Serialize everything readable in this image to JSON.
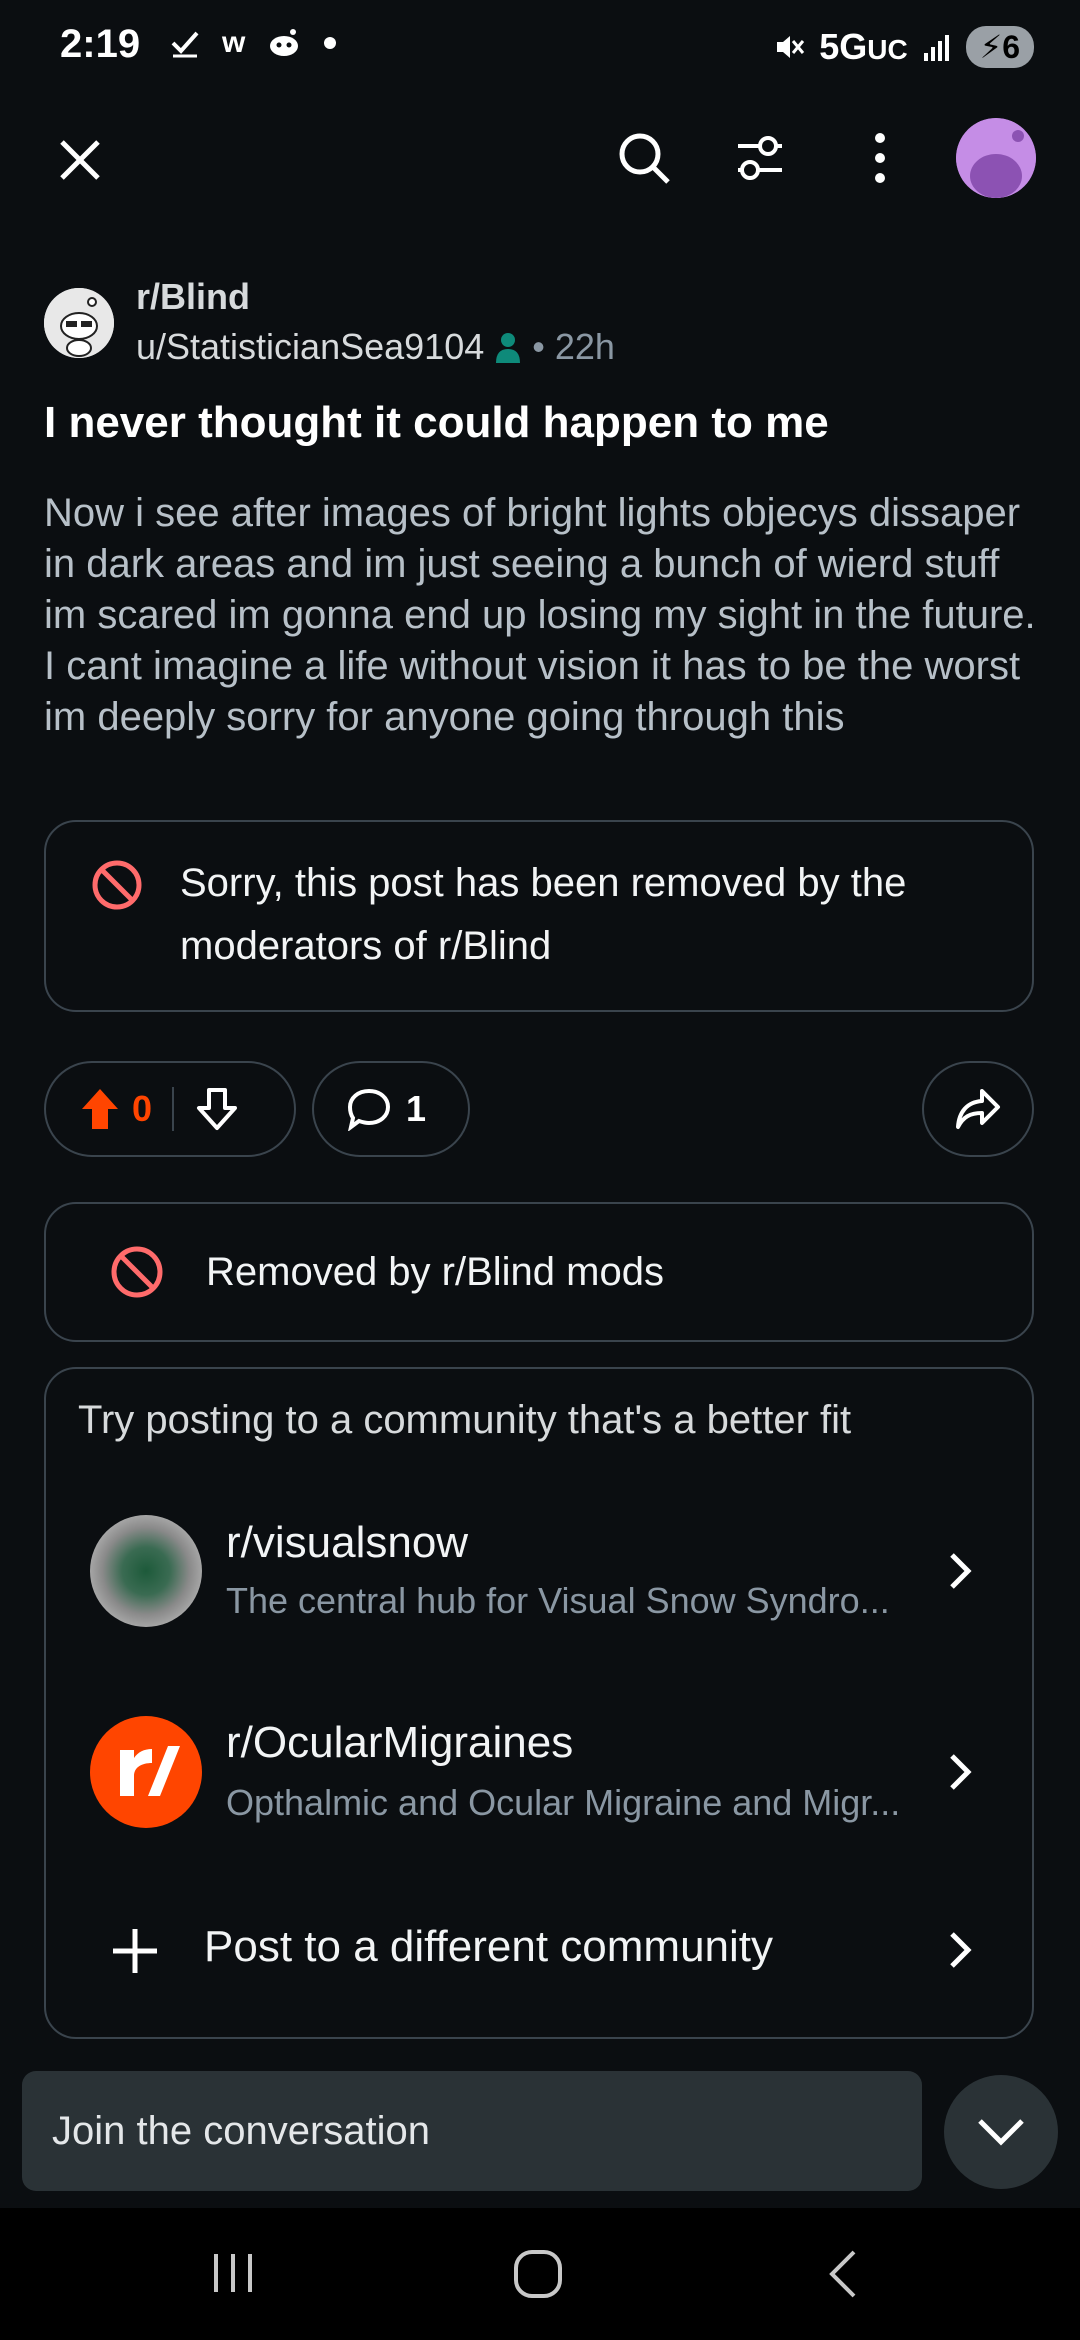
{
  "status_bar": {
    "time": "2:19",
    "network": "5G",
    "network_suffix": "UC",
    "battery": "6",
    "icons": [
      "check-icon",
      "w-icon",
      "reddit-icon",
      "dot-icon",
      "mute-icon",
      "signal-icon",
      "battery-charging-icon"
    ]
  },
  "top_bar": {
    "icons": [
      "close-icon",
      "search-icon",
      "filter-icon",
      "more-icon",
      "avatar"
    ]
  },
  "post": {
    "subreddit": "r/Blind",
    "author": "u/StatisticianSea9104",
    "age": "• 22h",
    "title": "I never thought it could happen to me",
    "body": "Now i see after images of bright lights objecys dissaper in dark areas and im just seeing a bunch of wierd stuff im scared im gonna end up losing my sight in the future. I cant imagine a life without vision it has to be the worst im deeply sorry for anyone going through this",
    "removed_notice": "Sorry, this post has been removed by the moderators of r/Blind",
    "upvotes": "0",
    "comments": "1"
  },
  "mod_notice": {
    "text": "Removed by r/Blind mods"
  },
  "suggestions": {
    "heading": "Try posting to a community that's a better fit",
    "communities": [
      {
        "name": "r/visualsnow",
        "description": "The central hub for Visual Snow Syndro..."
      },
      {
        "name": "r/OcularMigraines",
        "description": "Opthalmic and Ocular Migraine and Migr..."
      }
    ],
    "other_label": "Post to a different community"
  },
  "composer": {
    "placeholder": "Join the conversation"
  },
  "colors": {
    "background": "#0b0e11",
    "upvote_orange": "#ff4500",
    "removed_red": "#ff6b6b",
    "border": "#3a444d",
    "online_green": "#0e8a7a",
    "avatar_purple": "#b57bd9"
  }
}
